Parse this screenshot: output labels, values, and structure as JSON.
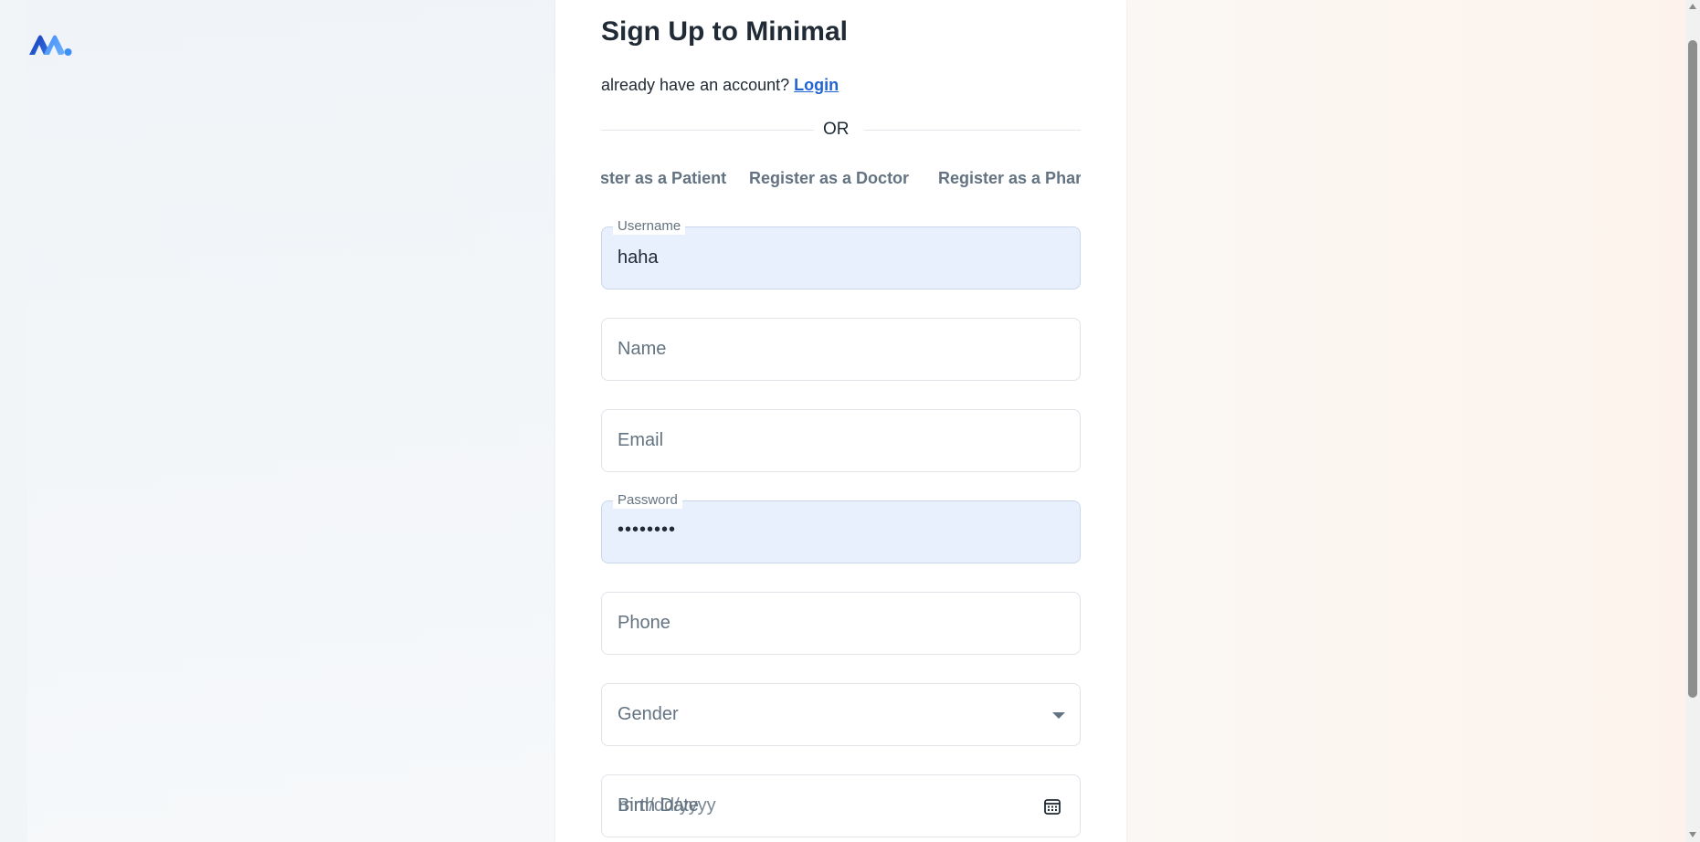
{
  "page": {
    "title": "Sign Up to Minimal",
    "account_prompt": "already have an account?",
    "login_link": "Login",
    "divider_text": "OR"
  },
  "tabs": [
    {
      "label": "Register as a Patient"
    },
    {
      "label": "Register as a Doctor"
    },
    {
      "label": "Register as a Pharmacist"
    }
  ],
  "form": {
    "username": {
      "label": "Username",
      "value": "haha"
    },
    "name": {
      "placeholder": "Name"
    },
    "email": {
      "placeholder": "Email"
    },
    "password": {
      "label": "Password",
      "value": "••••••••"
    },
    "phone": {
      "placeholder": "Phone"
    },
    "gender": {
      "placeholder": "Gender"
    },
    "birth_date": {
      "placeholder": "Birth Date",
      "format_hint": "mm/dd/yyyy"
    }
  },
  "colors": {
    "primary_link": "#2065d1",
    "logo_dark": "#1939b7",
    "logo_light": "#3e8ef7",
    "autofill_bg": "#e8f0fe"
  },
  "icons": {
    "logo": "minimal-logo",
    "gender_dropdown": "chevron-down-icon",
    "calendar": "calendar-icon"
  }
}
